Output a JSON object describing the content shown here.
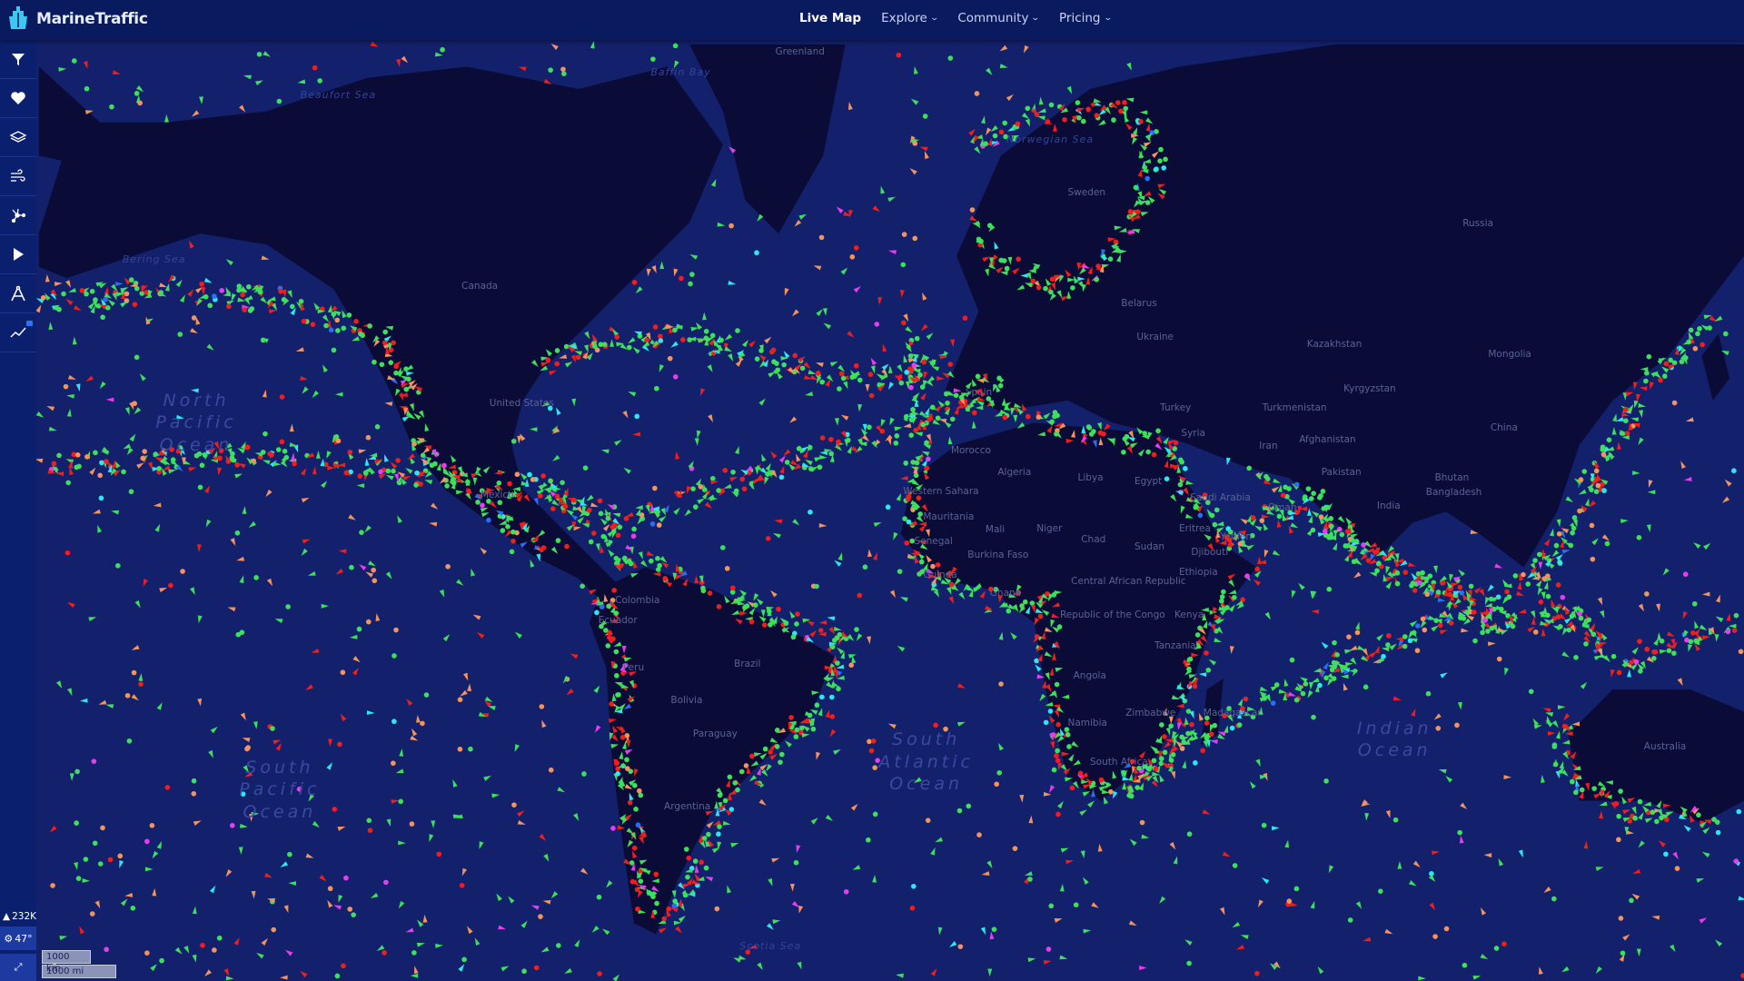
{
  "app": {
    "name": "MarineTraffic"
  },
  "nav": {
    "items": [
      {
        "label": "Live Map",
        "active": true,
        "dropdown": false
      },
      {
        "label": "Explore",
        "dropdown": true
      },
      {
        "label": "Community",
        "dropdown": true
      },
      {
        "label": "Pricing",
        "dropdown": true
      }
    ]
  },
  "sidebar": {
    "tools": [
      {
        "icon": "filter-icon"
      },
      {
        "icon": "heart-icon"
      },
      {
        "icon": "layers-icon"
      },
      {
        "icon": "wind-icon"
      },
      {
        "icon": "network-icon"
      },
      {
        "icon": "play-icon"
      },
      {
        "icon": "compass-icon"
      },
      {
        "icon": "analytics-icon",
        "locked": true
      }
    ],
    "vessel_count": "232K",
    "weather": "47°"
  },
  "scale": {
    "km": "1000 km",
    "mi": "1000 mi"
  },
  "map": {
    "colors": {
      "ocean": "#13206b",
      "land": "#0a0b36",
      "cargo": "#3de05a",
      "tanker": "#f21d1d",
      "fishing": "#f5935c",
      "passenger": "#2ee6f0",
      "pleasure": "#e83cf0",
      "tug": "#2a6ef5",
      "unknown": "#d9d9e8"
    },
    "labels": [
      "Greenland",
      "Beaufort Sea",
      "Baffin Bay",
      "Bering Sea",
      "Canada",
      "United States",
      "Mexico",
      "North Pacific Ocean",
      "South Pacific Ocean",
      "Colombia",
      "Ecuador",
      "Peru",
      "Brazil",
      "Bolivia",
      "Paraguay",
      "Argentina",
      "Scotia Sea",
      "Norwegian Sea",
      "Sweden",
      "Spain",
      "Morocco",
      "Algeria",
      "Libya",
      "Egypt",
      "Western Sahara",
      "Mauritania",
      "Mali",
      "Niger",
      "Chad",
      "Sudan",
      "Senegal",
      "Burkina Faso",
      "Guinea",
      "Ghana",
      "Central African Republic",
      "Republic of the Congo",
      "Ethiopia",
      "Kenya",
      "Tanzania",
      "Angola",
      "Namibia",
      "Zimbabwe",
      "South Africa",
      "Madagascar",
      "Belarus",
      "Ukraine",
      "Turkey",
      "Syria",
      "Iran",
      "Saudi Arabia",
      "Yemen",
      "Oman",
      "Eritrea",
      "Djibouti",
      "Kazakhstan",
      "Turkmenistan",
      "Kyrgyzstan",
      "Afghanistan",
      "Pakistan",
      "India",
      "Bhutan",
      "Bangladesh",
      "Russia",
      "Mongolia",
      "China",
      "Australia",
      "South Atlantic Ocean",
      "Indian Ocean"
    ]
  }
}
